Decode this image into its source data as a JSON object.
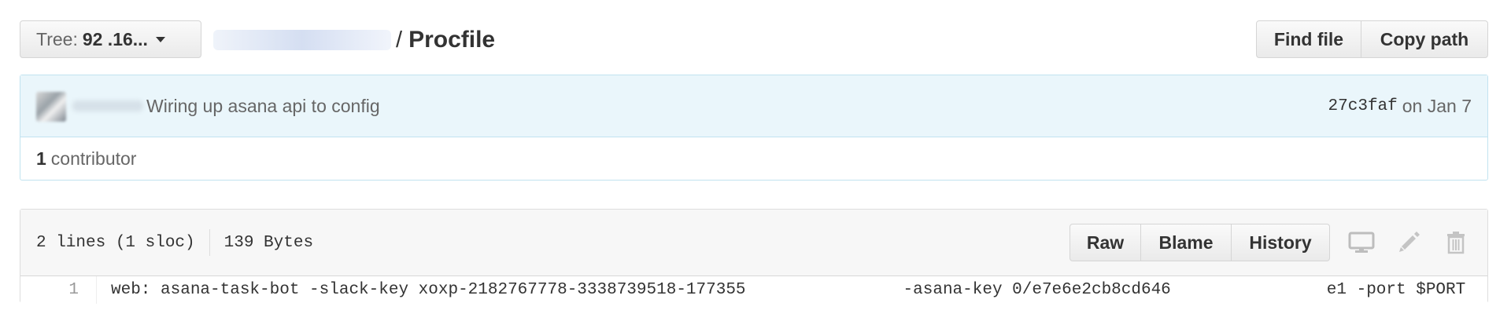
{
  "nav": {
    "tree_label": "Tree:",
    "tree_value": "92 .16...",
    "breadcrumb_separator": "/",
    "file_name": "Procfile",
    "buttons": {
      "find_file": "Find file",
      "copy_path": "Copy path"
    }
  },
  "commit": {
    "message": "Wiring up asana api to config",
    "sha": "27c3faf",
    "date_text": "on Jan 7",
    "contributor_count": "1",
    "contributor_label": "contributor"
  },
  "file": {
    "lines_info": "2 lines (1 sloc)",
    "size": "139 Bytes",
    "buttons": {
      "raw": "Raw",
      "blame": "Blame",
      "history": "History"
    },
    "icons": [
      "desktop-icon",
      "pencil-icon",
      "trash-icon"
    ],
    "code": [
      {
        "number": "1",
        "text_part1": "web: asana-task-bot -slack-key xoxp-2182767778-3338739518-177355",
        "text_part2": "-asana-key 0/e7e6e2cb8cd646",
        "text_part3": "e1 -port $PORT"
      }
    ]
  },
  "colors": {
    "commit_bg": "#eaf6fb",
    "commit_border": "#c1e3f0",
    "button_border": "#d5d5d5",
    "header_bg": "#f7f7f7"
  }
}
